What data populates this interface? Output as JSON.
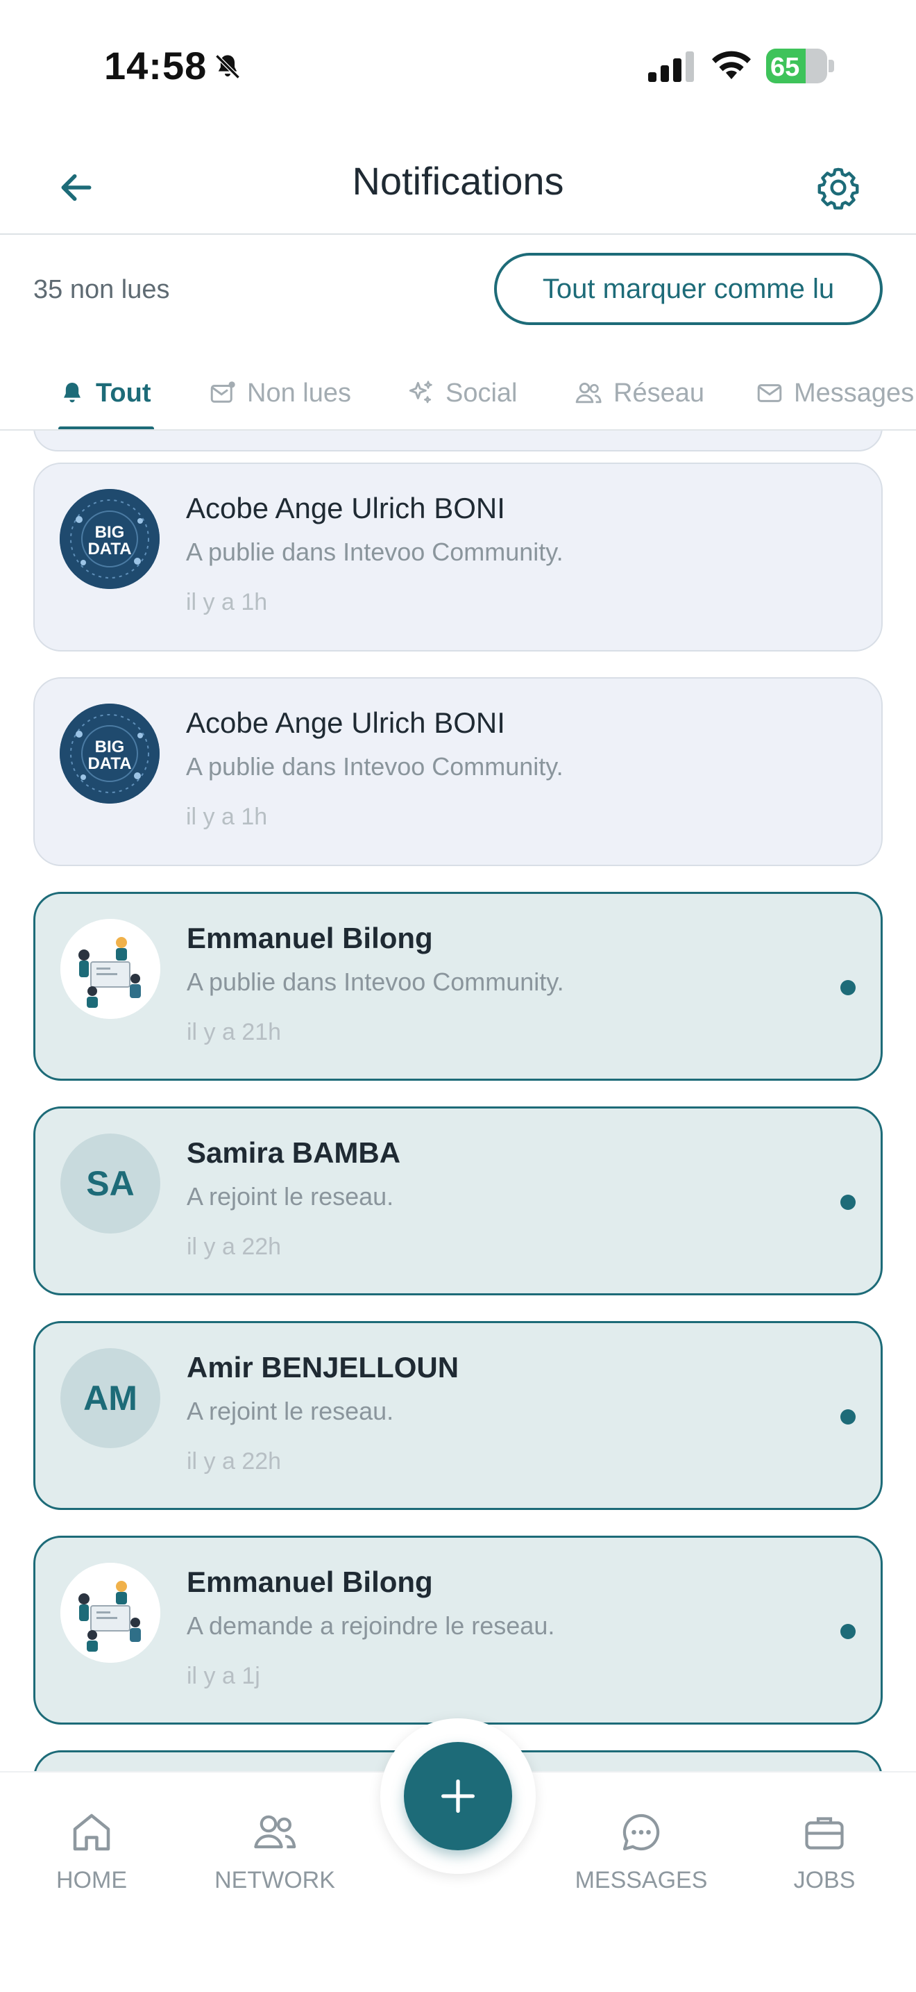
{
  "status_bar": {
    "time": "14:58",
    "battery": "65",
    "battery_level": 0.65
  },
  "header": {
    "title": "Notifications",
    "back_icon": "arrow-left-icon",
    "settings_icon": "gear-icon"
  },
  "subheader": {
    "unread_count": "35 non lues",
    "mark_all_label": "Tout marquer comme lu"
  },
  "tabs": [
    {
      "label": "Tout",
      "icon": "bell-icon",
      "active": true
    },
    {
      "label": "Non lues",
      "icon": "mail-dot-icon",
      "active": false
    },
    {
      "label": "Social",
      "icon": "sparkles-icon",
      "active": false
    },
    {
      "label": "Réseau",
      "icon": "users-icon",
      "active": false
    },
    {
      "label": "Messages",
      "icon": "envelope-icon",
      "active": false
    }
  ],
  "notifications": [
    {
      "name": "Acobe Ange Ulrich BONI",
      "message": "A publie dans Intevoo Community.",
      "time": "il y a 1h",
      "unread": false,
      "avatar": "bigdata-image",
      "avatar_text": "BIG DATA"
    },
    {
      "name": "Acobe Ange Ulrich BONI",
      "message": "A publie dans Intevoo Community.",
      "time": "il y a 1h",
      "unread": false,
      "avatar": "bigdata-image",
      "avatar_text": "BIG DATA"
    },
    {
      "name": "Emmanuel Bilong",
      "message": "A publie dans Intevoo Community.",
      "time": "il y a 21h",
      "unread": true,
      "avatar": "illustration-image"
    },
    {
      "name": "Samira BAMBA",
      "message": "A rejoint le reseau.",
      "time": "il y a 22h",
      "unread": true,
      "avatar": "initials",
      "initials": "SA"
    },
    {
      "name": "Amir BENJELLOUN",
      "message": "A rejoint le reseau.",
      "time": "il y a 22h",
      "unread": true,
      "avatar": "initials",
      "initials": "AM"
    },
    {
      "name": "Emmanuel Bilong",
      "message": "A demande a rejoindre le reseau.",
      "time": "il y a 1j",
      "unread": true,
      "avatar": "illustration-image"
    }
  ],
  "bottom_nav": {
    "items": [
      {
        "label": "HOME",
        "icon": "home-icon"
      },
      {
        "label": "NETWORK",
        "icon": "users-icon"
      },
      {
        "label": "MESSAGES",
        "icon": "chat-icon"
      },
      {
        "label": "JOBS",
        "icon": "briefcase-icon"
      }
    ],
    "fab_icon": "plus-icon"
  },
  "colors": {
    "accent": "#1d6b78",
    "unread_bg": "#e1eced",
    "read_bg": "#eef1f8"
  }
}
